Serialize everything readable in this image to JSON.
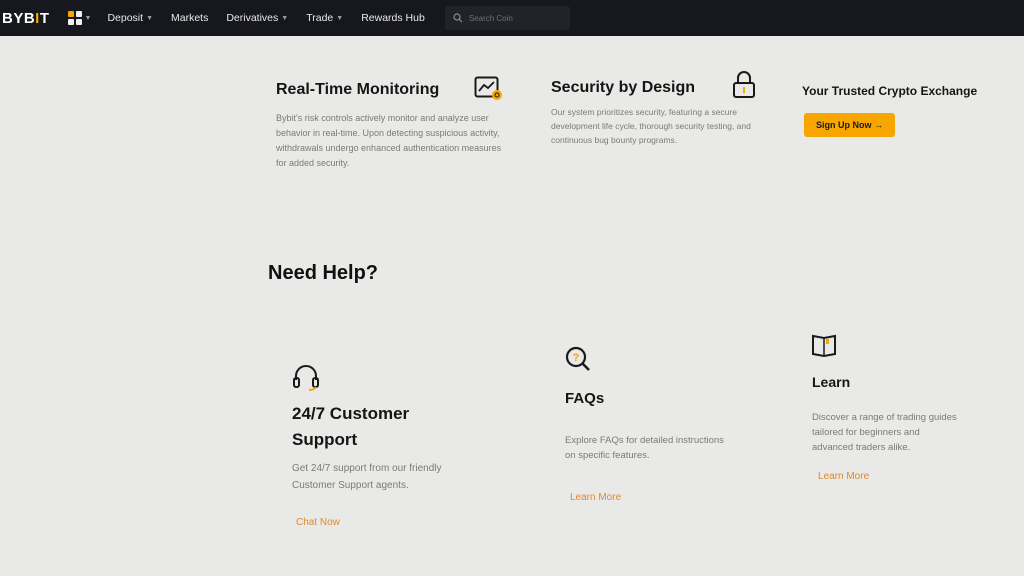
{
  "nav": {
    "logo_main": "BYB",
    "logo_accent": "I",
    "logo_end": "T",
    "items": [
      "Deposit",
      "Markets",
      "Derivatives",
      "Trade",
      "Rewards Hub"
    ],
    "search_placeholder": "Search Coin"
  },
  "features": [
    {
      "title": "Real-Time Monitoring",
      "desc": "Bybit's risk controls actively monitor and analyze user behavior in real-time. Upon detecting suspicious activity, withdrawals undergo enhanced authentication measures for added security.",
      "icon": "chart-monitor-icon"
    },
    {
      "title": "Security by Design",
      "desc": "Our system prioritizes security, featuring a secure development life cycle, thorough security testing, and continuous bug bounty programs.",
      "icon": "padlock-icon"
    }
  ],
  "trusted": {
    "title": "Your Trusted Crypto Exchange",
    "button_label": "Sign Up Now →"
  },
  "help": {
    "title": "Need Help?",
    "cards": [
      {
        "title_line1": "24/7 Customer",
        "title_line2": "Support",
        "desc": "Get 24/7 support from our friendly Customer Support agents.",
        "link": "Chat Now",
        "icon": "headset-icon"
      },
      {
        "title": "FAQs",
        "desc": "Explore FAQs for detailed instructions on specific features.",
        "link": "Learn More",
        "icon": "magnifier-question-icon"
      },
      {
        "title": "Learn",
        "desc": "Discover a range of trading guides tailored for beginners and advanced traders alike.",
        "link": "Learn More",
        "icon": "book-icon"
      }
    ]
  },
  "colors": {
    "nav_bg": "#17181e",
    "accent": "#f7a600",
    "link": "#e08a2a",
    "page_bg": "#e9e9e7"
  }
}
